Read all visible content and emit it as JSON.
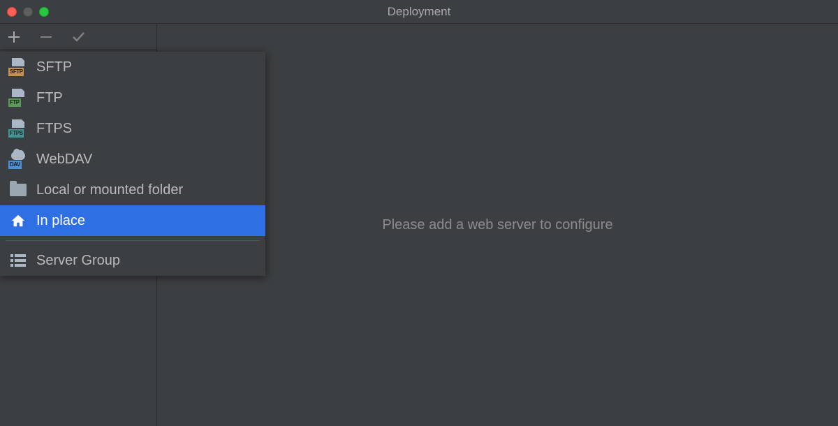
{
  "window": {
    "title": "Deployment"
  },
  "main": {
    "placeholder": "Please add a web server to configure"
  },
  "popup": {
    "items": [
      {
        "label": "SFTP",
        "tag": "SFTP",
        "tagClass": "tag-orange",
        "type": "proto",
        "selected": false
      },
      {
        "label": "FTP",
        "tag": "FTP",
        "tagClass": "tag-green",
        "type": "proto",
        "selected": false
      },
      {
        "label": "FTPS",
        "tag": "FTPS",
        "tagClass": "tag-teal",
        "type": "proto",
        "selected": false
      },
      {
        "label": "WebDAV",
        "tag": "DAV",
        "tagClass": "tag-blue",
        "type": "dav",
        "selected": false
      },
      {
        "label": "Local or mounted folder",
        "type": "folder",
        "selected": false
      },
      {
        "label": "In place",
        "type": "home",
        "selected": true
      }
    ],
    "groupItem": {
      "label": "Server Group",
      "type": "stack"
    }
  }
}
